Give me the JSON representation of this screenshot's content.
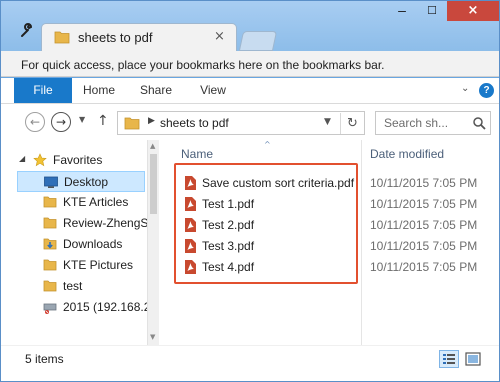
{
  "window": {
    "tab_title": "sheets to pdf",
    "tab_close_glyph": "×",
    "minimize_glyph": "–",
    "maximize_glyph": "☐",
    "close_glyph": "×"
  },
  "bookmarks_bar": {
    "text": "For quick access, place your bookmarks here on the bookmarks bar."
  },
  "ribbon": {
    "tabs": [
      {
        "label": "File"
      },
      {
        "label": "Home"
      },
      {
        "label": "Share"
      },
      {
        "label": "View"
      }
    ],
    "help_glyph": "?",
    "expand_glyph": "⌄"
  },
  "navigation": {
    "back_glyph": "←",
    "forward_glyph": "→",
    "recent_glyph": "▼",
    "up_glyph": "↑",
    "address_separator": "▶",
    "address_path": "sheets to pdf",
    "address_dropdown_glyph": "▼",
    "refresh_glyph": "↻",
    "search_placeholder": "Search sh..."
  },
  "sidebar": {
    "favorites_label": "Favorites",
    "expand_glyph": "◢",
    "items": [
      {
        "label": "Desktop",
        "icon": "desktop-icon",
        "selected": true
      },
      {
        "label": "KTE Articles",
        "icon": "folder-icon"
      },
      {
        "label": "Review-ZhengS",
        "icon": "folder-icon"
      },
      {
        "label": "Downloads",
        "icon": "downloads-icon"
      },
      {
        "label": "KTE Pictures",
        "icon": "folder-icon"
      },
      {
        "label": "test",
        "icon": "folder-icon"
      },
      {
        "label": "2015 (192.168.2",
        "icon": "network-drive-icon"
      }
    ]
  },
  "file_list": {
    "columns": {
      "name": "Name",
      "date_modified": "Date modified"
    },
    "sort_glyph": "^",
    "files": [
      {
        "name": "Save custom sort criteria.pdf",
        "date": "10/11/2015 7:05 PM",
        "icon": "pdf-icon"
      },
      {
        "name": "Test 1.pdf",
        "date": "10/11/2015 7:05 PM",
        "icon": "pdf-icon"
      },
      {
        "name": "Test 2.pdf",
        "date": "10/11/2015 7:05 PM",
        "icon": "pdf-icon"
      },
      {
        "name": "Test 3.pdf",
        "date": "10/11/2015 7:05 PM",
        "icon": "pdf-icon"
      },
      {
        "name": "Test 4.pdf",
        "date": "10/11/2015 7:05 PM",
        "icon": "pdf-icon"
      }
    ]
  },
  "status_bar": {
    "item_count": "5 items"
  },
  "colors": {
    "accent": "#1979ca",
    "highlight_border": "#e2502f",
    "close_button": "#c9483d",
    "selection": "#cde8ff",
    "folder": "#e8b64a",
    "pdf": "#c8492f"
  }
}
